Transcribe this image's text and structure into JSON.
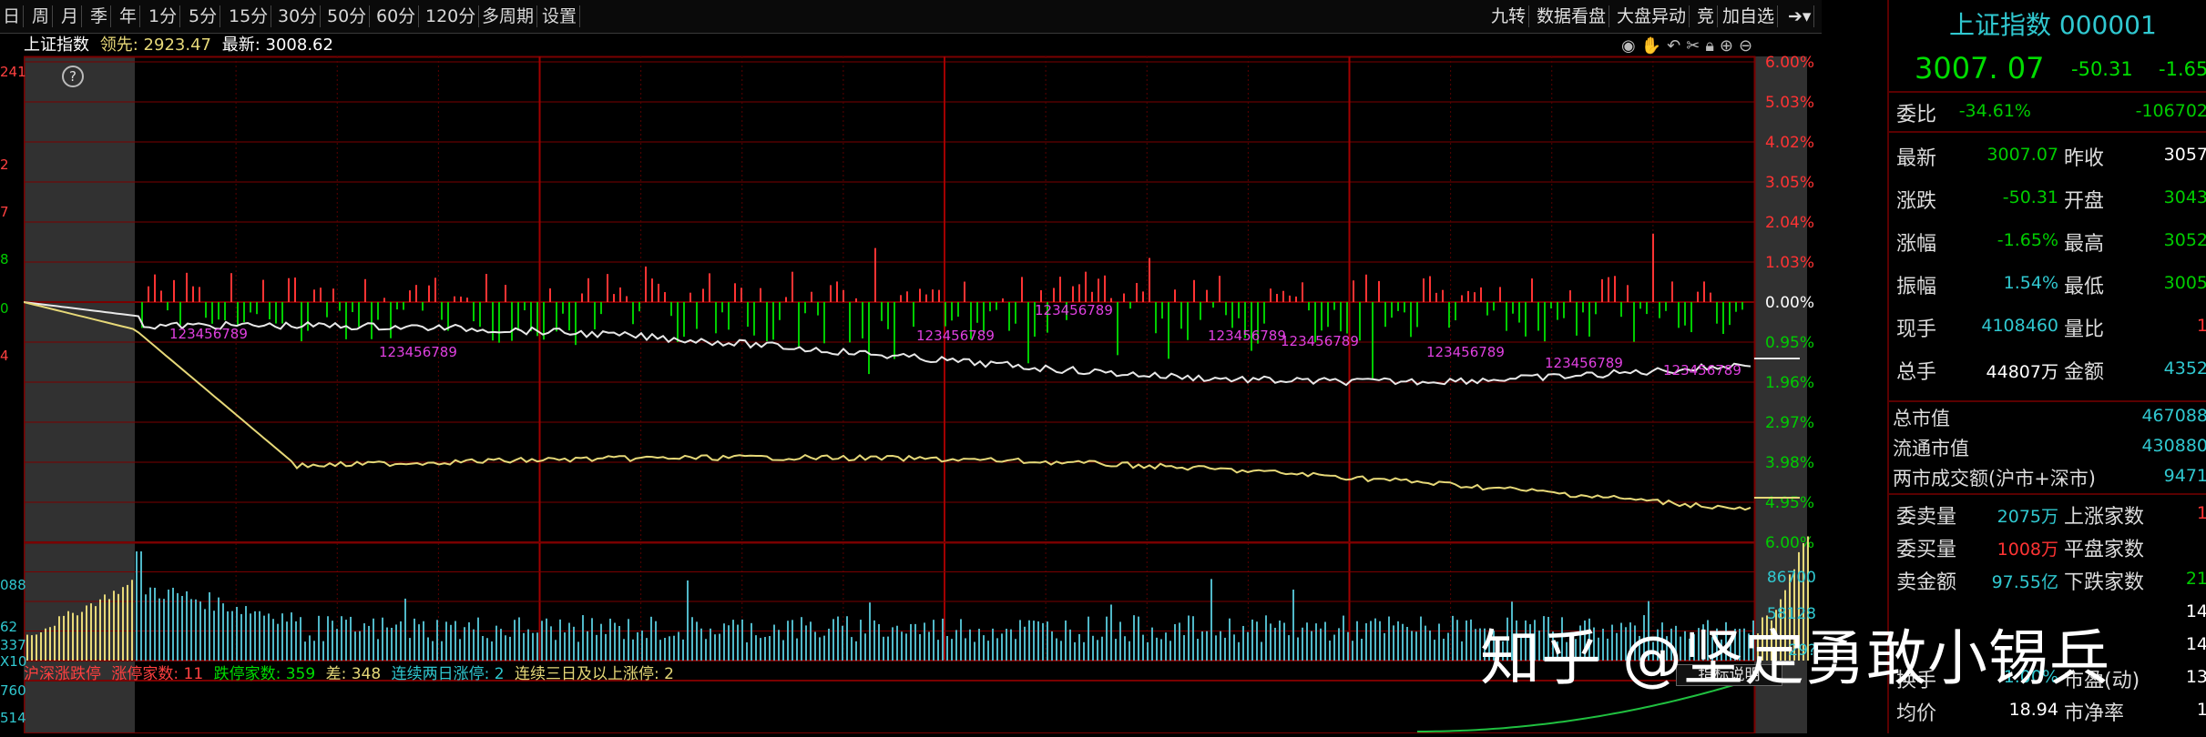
{
  "toolbar": {
    "left_items": [
      "日",
      "周",
      "月",
      "季",
      "年",
      "1分",
      "5分",
      "15分",
      "30分",
      "50分",
      "60分",
      "120分",
      "多周期",
      "设置"
    ],
    "right_items": [
      "九转",
      "数据看盘",
      "大盘异动",
      "竞",
      "加自选"
    ],
    "arrow_icon": "export-icon"
  },
  "chart_header": {
    "index_name": "上证指数",
    "lead_label": "领先:",
    "lead_value": "2923.47",
    "latest_label": "最新:",
    "latest_value": "3008.62",
    "help_icon": "?"
  },
  "left_edge_labels": [
    "241",
    "2",
    "7",
    "8",
    "0",
    "4",
    "088",
    "62",
    "337",
    "X10",
    "760",
    "514"
  ],
  "price_axis_right": [
    "6.00%",
    "5.03%",
    "4.02%",
    "3.05%",
    "2.04%",
    "1.03%",
    "0.00%",
    "0.95%",
    "1.96%",
    "2.97%",
    "3.98%",
    "4.95%",
    "6.00%"
  ],
  "volume_axis_right": [
    "86700",
    "58128",
    "29?"
  ],
  "td_sequence_labels": [
    "123456789",
    "123456789",
    "123456789",
    "123456789",
    "123456789",
    "123456789",
    "123456789",
    "123456789",
    "123456789"
  ],
  "limit_bar": {
    "title": "沪深涨跌停",
    "up_label": "涨停家数:",
    "up_value": "11",
    "down_label": "跌停家数:",
    "down_value": "359",
    "diff_label": "差:",
    "diff_value": "348",
    "two_day_label": "连续两日涨停:",
    "two_day_value": "2",
    "three_day_label": "连续三日及以上涨停:",
    "three_day_value": "2",
    "explain_button": "指标说明"
  },
  "quote": {
    "title": "上证指数 000001",
    "price": "3007. 07",
    "change": "-50.31",
    "change_pct": "-1.65",
    "rows_a": [
      {
        "label": "委比",
        "value": "-34.61%",
        "label2": "",
        "value2": "-106702"
      }
    ],
    "rows_b": [
      {
        "label": "最新",
        "value": "3007.07",
        "label2": "昨收",
        "value2": "3057"
      },
      {
        "label": "涨跌",
        "value": "-50.31",
        "label2": "开盘",
        "value2": "3043"
      },
      {
        "label": "涨幅",
        "value": "-1.65%",
        "label2": "最高",
        "value2": "3052"
      },
      {
        "label": "振幅",
        "value": "1.54%",
        "label2": "最低",
        "value2": "3005"
      },
      {
        "label": "现手",
        "value": "4108460",
        "label2": "量比",
        "value2": "1"
      },
      {
        "label": "总手",
        "value": "44807万",
        "label2": "金额",
        "value2": "4352"
      }
    ],
    "rows_c": [
      {
        "label": "总市值",
        "value": "467088"
      },
      {
        "label": "流通市值",
        "value": "430880"
      },
      {
        "label": "两市成交额(沪市+深市)",
        "value": "9471"
      }
    ],
    "rows_d": [
      {
        "label": "委卖量",
        "value": "2075万",
        "label2": "上涨家数",
        "value2": "1"
      },
      {
        "label": "委买量",
        "value": "1008万",
        "label2": "平盘家数",
        "value2": ""
      },
      {
        "label": "卖金额",
        "value": "97.55亿",
        "label2": "下跌家数",
        "value2": "21"
      },
      {
        "label": "",
        "value": "",
        "label2": "",
        "value2": "14"
      },
      {
        "label": "",
        "value": "",
        "label2": "",
        "value2": "14"
      },
      {
        "label": "换手",
        "value": "1.00%",
        "label2": "市盈(动)",
        "value2": "13"
      },
      {
        "label": "均价",
        "value": "18.94",
        "label2": "市净率",
        "value2": "1"
      }
    ]
  },
  "watermark": "知乎 @坚定勇敢小锡兵",
  "colors": {
    "up": "#ff3333",
    "down": "#00cc00",
    "grid": "#7a0000",
    "white_line": "#e8e8e8",
    "yellow_line": "#e6d878",
    "cyan": "#30c8d0",
    "magenta": "#e040e0"
  }
}
